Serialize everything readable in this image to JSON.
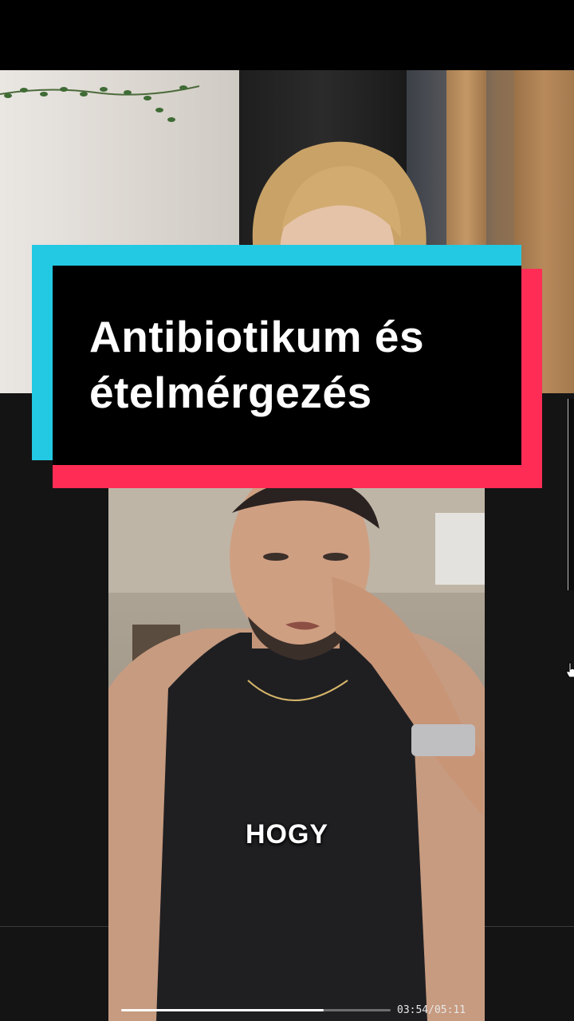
{
  "title_card": {
    "line1": "Antibiotikum és",
    "line2": "ételmérgezés"
  },
  "caption": "HOGY",
  "player": {
    "time": "03:54/05:11",
    "progress_fraction": 0.75
  },
  "colors": {
    "card_cyan": "#23c9e3",
    "card_red": "#ff2d55",
    "card_black": "#000000"
  },
  "icons": {
    "cursor": "hand-pointer-icon"
  }
}
